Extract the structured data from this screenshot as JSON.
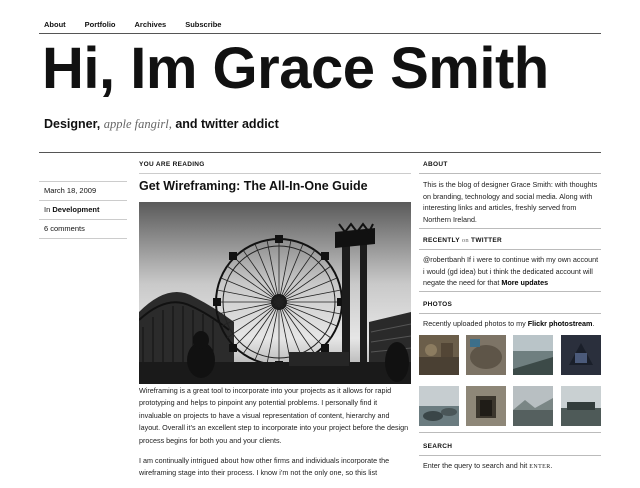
{
  "nav": [
    "About",
    "Portfolio",
    "Archives",
    "Subscribe"
  ],
  "site": {
    "title": "Hi, Im Grace Smith",
    "tagline_pre": "Designer,",
    "tagline_ital": "apple fangirl,",
    "tagline_post": "and twitter addict"
  },
  "meta": {
    "date": "March 18, 2009",
    "in_label": "In",
    "category": "Development",
    "comments": "6 comments"
  },
  "post": {
    "kicker": "YOU ARE READING",
    "title": "Get Wireframing: The All-In-One Guide",
    "p1": "Wireframing is a great tool to incorporate into your projects as it allows for rapid prototyping and helps to pinpoint any potential problems. I personally find it invaluable on projects to have a visual representation of content, hierarchy and layout. Overall it’s an excellent step to incorporate into your project before the design process begins for both you and your clients.",
    "p2": "I am continually intrigued about how other firms and individuals incorporate the wireframing stage into their process. I know i’m not the only one, so this list"
  },
  "sidebar": {
    "about_h": "ABOUT",
    "about_text": "This is the blog of designer Grace Smith: with thoughts on branding, technology and social media. Along with interesting links and articles, freshly served from Northern Ireland.",
    "recent_h_pre": "RECENTLY",
    "recent_h_on": "on",
    "recent_h_post": "TWITTER",
    "tweet_text": "@robertbanh If i were to continue with my own account i would (gd idea) but i think the dedicated account will negate the need for that",
    "tweet_link": "More updates",
    "photos_h": "PHOTOS",
    "photos_text": "Recently uploaded photos to my",
    "photos_link": "Flickr photostream",
    "search_h": "SEARCH",
    "search_text": "Enter the query to search and hit",
    "search_key": "ENTER"
  }
}
